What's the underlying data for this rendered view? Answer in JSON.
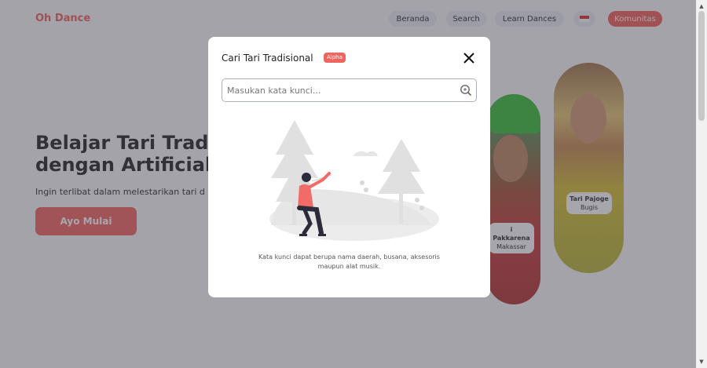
{
  "brand": {
    "name": "Oh Dance",
    "color": "#f0635f"
  },
  "nav": {
    "items": [
      {
        "label": "Beranda"
      },
      {
        "label": "Search"
      },
      {
        "label": "Learn Dances"
      }
    ],
    "flag_icon": "indonesia-flag-icon",
    "community_label": "Komunitas"
  },
  "hero": {
    "title_line1": "Belajar Tari Trad",
    "title_line2": "dengan Artificial",
    "subtitle": "Ingin terlibat dalam melestarikan tari d",
    "cta_label": "Ayo Mulai"
  },
  "dancers": [
    {
      "name": "i Pakkarena",
      "place": "Makassar"
    },
    {
      "name": "Tari Pajoge",
      "place": "Bugis"
    }
  ],
  "modal": {
    "title": "Cari Tari Tradisional",
    "badge": "Alpha",
    "search_placeholder": "Masukan kata kunci...",
    "search_icon": "search-icon",
    "close_icon": "close-icon",
    "hint_line1": "Kata kunci dapat berupa nama daerah, busana, aksesoris",
    "hint_line2": "maupun alat musik."
  },
  "colors": {
    "accent": "#f06460",
    "overlay": "rgba(60,58,70,0.45)"
  }
}
